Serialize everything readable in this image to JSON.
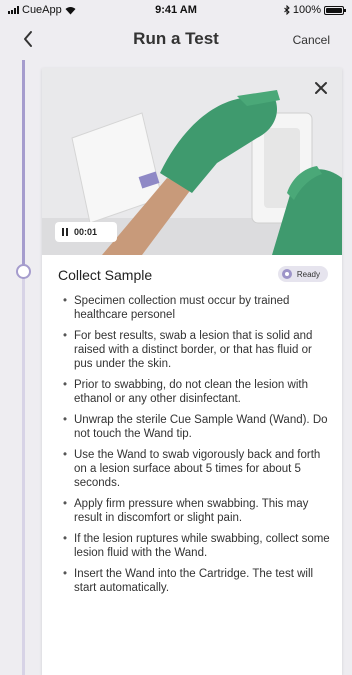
{
  "status_bar": {
    "carrier": "CueApp",
    "time": "9:41 AM",
    "battery": "100%"
  },
  "nav": {
    "back_icon": "chevron-left-icon",
    "title": "Run a Test",
    "cancel_label": "Cancel"
  },
  "video": {
    "timer": "00:01",
    "close_icon": "close-icon"
  },
  "step": {
    "title": "Collect Sample",
    "badge": "Ready",
    "instructions": [
      "Specimen collection must occur by trained healthcare personel",
      "For best results, swab a lesion that is solid and raised with a distinct border, or that has fluid or pus under the skin.",
      "Prior to swabbing, do not clean the lesion with ethanol or any other disinfectant.",
      "Unwrap the sterile Cue Sample Wand (Wand). Do not touch the Wand tip.",
      "Use the Wand to swab vigorously back and forth on a lesion surface about 5 times for about 5 seconds.",
      "Apply firm pressure when swabbing. This may result in discomfort or slight pain.",
      "If the lesion ruptures while swabbing, collect some lesion fluid with the Wand.",
      "Insert the Wand into the Cartridge. The test will start automatically."
    ]
  },
  "colors": {
    "accent": "#a59ccd",
    "glove": "#3f9a6e",
    "background": "#eeedf1"
  }
}
